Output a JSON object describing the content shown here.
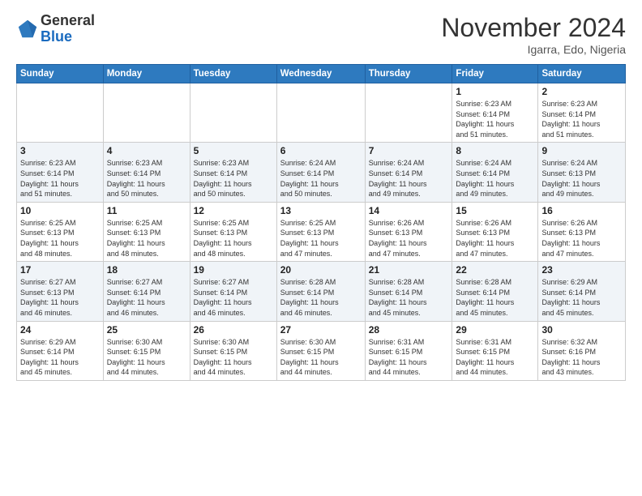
{
  "header": {
    "logo_line1": "General",
    "logo_line2": "Blue",
    "month": "November 2024",
    "location": "Igarra, Edo, Nigeria"
  },
  "weekdays": [
    "Sunday",
    "Monday",
    "Tuesday",
    "Wednesday",
    "Thursday",
    "Friday",
    "Saturday"
  ],
  "weeks": [
    [
      {
        "day": "",
        "info": ""
      },
      {
        "day": "",
        "info": ""
      },
      {
        "day": "",
        "info": ""
      },
      {
        "day": "",
        "info": ""
      },
      {
        "day": "",
        "info": ""
      },
      {
        "day": "1",
        "info": "Sunrise: 6:23 AM\nSunset: 6:14 PM\nDaylight: 11 hours\nand 51 minutes."
      },
      {
        "day": "2",
        "info": "Sunrise: 6:23 AM\nSunset: 6:14 PM\nDaylight: 11 hours\nand 51 minutes."
      }
    ],
    [
      {
        "day": "3",
        "info": "Sunrise: 6:23 AM\nSunset: 6:14 PM\nDaylight: 11 hours\nand 51 minutes."
      },
      {
        "day": "4",
        "info": "Sunrise: 6:23 AM\nSunset: 6:14 PM\nDaylight: 11 hours\nand 50 minutes."
      },
      {
        "day": "5",
        "info": "Sunrise: 6:23 AM\nSunset: 6:14 PM\nDaylight: 11 hours\nand 50 minutes."
      },
      {
        "day": "6",
        "info": "Sunrise: 6:24 AM\nSunset: 6:14 PM\nDaylight: 11 hours\nand 50 minutes."
      },
      {
        "day": "7",
        "info": "Sunrise: 6:24 AM\nSunset: 6:14 PM\nDaylight: 11 hours\nand 49 minutes."
      },
      {
        "day": "8",
        "info": "Sunrise: 6:24 AM\nSunset: 6:14 PM\nDaylight: 11 hours\nand 49 minutes."
      },
      {
        "day": "9",
        "info": "Sunrise: 6:24 AM\nSunset: 6:13 PM\nDaylight: 11 hours\nand 49 minutes."
      }
    ],
    [
      {
        "day": "10",
        "info": "Sunrise: 6:25 AM\nSunset: 6:13 PM\nDaylight: 11 hours\nand 48 minutes."
      },
      {
        "day": "11",
        "info": "Sunrise: 6:25 AM\nSunset: 6:13 PM\nDaylight: 11 hours\nand 48 minutes."
      },
      {
        "day": "12",
        "info": "Sunrise: 6:25 AM\nSunset: 6:13 PM\nDaylight: 11 hours\nand 48 minutes."
      },
      {
        "day": "13",
        "info": "Sunrise: 6:25 AM\nSunset: 6:13 PM\nDaylight: 11 hours\nand 47 minutes."
      },
      {
        "day": "14",
        "info": "Sunrise: 6:26 AM\nSunset: 6:13 PM\nDaylight: 11 hours\nand 47 minutes."
      },
      {
        "day": "15",
        "info": "Sunrise: 6:26 AM\nSunset: 6:13 PM\nDaylight: 11 hours\nand 47 minutes."
      },
      {
        "day": "16",
        "info": "Sunrise: 6:26 AM\nSunset: 6:13 PM\nDaylight: 11 hours\nand 47 minutes."
      }
    ],
    [
      {
        "day": "17",
        "info": "Sunrise: 6:27 AM\nSunset: 6:13 PM\nDaylight: 11 hours\nand 46 minutes."
      },
      {
        "day": "18",
        "info": "Sunrise: 6:27 AM\nSunset: 6:14 PM\nDaylight: 11 hours\nand 46 minutes."
      },
      {
        "day": "19",
        "info": "Sunrise: 6:27 AM\nSunset: 6:14 PM\nDaylight: 11 hours\nand 46 minutes."
      },
      {
        "day": "20",
        "info": "Sunrise: 6:28 AM\nSunset: 6:14 PM\nDaylight: 11 hours\nand 46 minutes."
      },
      {
        "day": "21",
        "info": "Sunrise: 6:28 AM\nSunset: 6:14 PM\nDaylight: 11 hours\nand 45 minutes."
      },
      {
        "day": "22",
        "info": "Sunrise: 6:28 AM\nSunset: 6:14 PM\nDaylight: 11 hours\nand 45 minutes."
      },
      {
        "day": "23",
        "info": "Sunrise: 6:29 AM\nSunset: 6:14 PM\nDaylight: 11 hours\nand 45 minutes."
      }
    ],
    [
      {
        "day": "24",
        "info": "Sunrise: 6:29 AM\nSunset: 6:14 PM\nDaylight: 11 hours\nand 45 minutes."
      },
      {
        "day": "25",
        "info": "Sunrise: 6:30 AM\nSunset: 6:15 PM\nDaylight: 11 hours\nand 44 minutes."
      },
      {
        "day": "26",
        "info": "Sunrise: 6:30 AM\nSunset: 6:15 PM\nDaylight: 11 hours\nand 44 minutes."
      },
      {
        "day": "27",
        "info": "Sunrise: 6:30 AM\nSunset: 6:15 PM\nDaylight: 11 hours\nand 44 minutes."
      },
      {
        "day": "28",
        "info": "Sunrise: 6:31 AM\nSunset: 6:15 PM\nDaylight: 11 hours\nand 44 minutes."
      },
      {
        "day": "29",
        "info": "Sunrise: 6:31 AM\nSunset: 6:15 PM\nDaylight: 11 hours\nand 44 minutes."
      },
      {
        "day": "30",
        "info": "Sunrise: 6:32 AM\nSunset: 6:16 PM\nDaylight: 11 hours\nand 43 minutes."
      }
    ]
  ]
}
